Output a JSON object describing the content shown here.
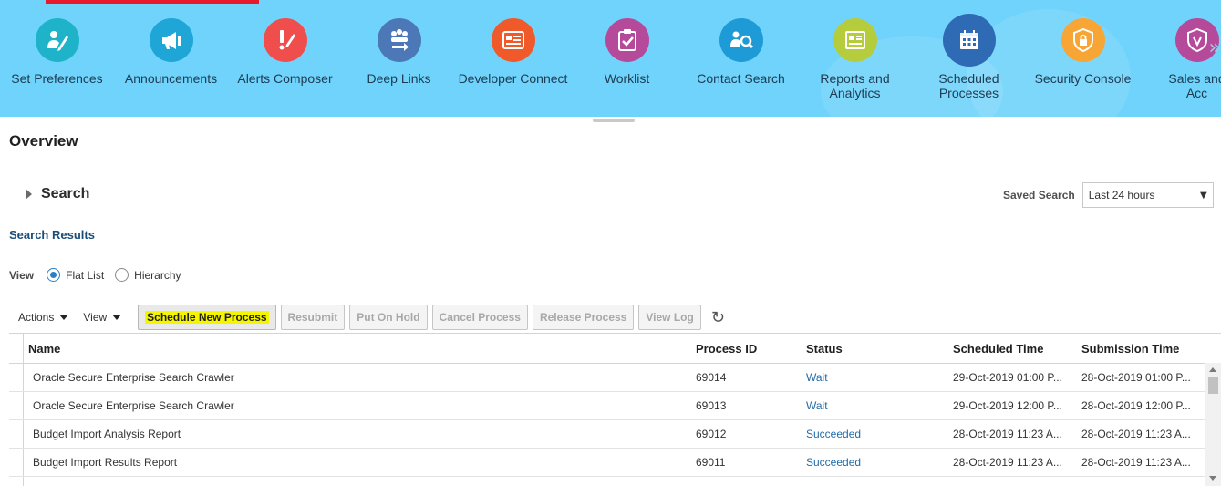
{
  "springboard": {
    "tiles": [
      {
        "label": "Set Preferences",
        "icon": "set-preferences-icon",
        "color": "#1fb3c9"
      },
      {
        "label": "Announcements",
        "icon": "megaphone-icon",
        "color": "#1fa5d6"
      },
      {
        "label": "Alerts Composer",
        "icon": "alert-composer-icon",
        "color": "#f04d4d"
      },
      {
        "label": "Deep Links",
        "icon": "deep-links-icon",
        "color": "#4c78b8"
      },
      {
        "label": "Developer Connect",
        "icon": "developer-connect-icon",
        "color": "#f05a2a"
      },
      {
        "label": "Worklist",
        "icon": "worklist-icon",
        "color": "#b64a9a"
      },
      {
        "label": "Contact Search",
        "icon": "contact-search-icon",
        "color": "#1e9ad6"
      },
      {
        "label": "Reports and Analytics",
        "icon": "reports-icon",
        "color": "#b5cc3d"
      },
      {
        "label": "Scheduled Processes",
        "icon": "calendar-icon",
        "color": "#2f6bb5"
      },
      {
        "label": "Security Console",
        "icon": "shield-lock-icon",
        "color": "#f7a535"
      },
      {
        "label": "Sales and Acc",
        "icon": "shield-icon",
        "color": "#b64a9a"
      }
    ],
    "chevron_glyph": "»"
  },
  "overview": {
    "title": "Overview",
    "search_label": "Search",
    "saved_search_label": "Saved Search",
    "saved_search_value": "Last 24 hours",
    "results_title": "Search Results"
  },
  "view": {
    "label": "View",
    "options": [
      "Flat List",
      "Hierarchy"
    ],
    "selected": "Flat List"
  },
  "toolbar": {
    "actions_label": "Actions",
    "view_label": "View",
    "buttons": {
      "schedule": "Schedule New Process",
      "resubmit": "Resubmit",
      "hold": "Put On Hold",
      "cancel": "Cancel Process",
      "release": "Release Process",
      "log": "View Log"
    },
    "refresh_glyph": "↻"
  },
  "table": {
    "columns": [
      "Name",
      "Process ID",
      "Status",
      "Scheduled Time",
      "Submission Time"
    ],
    "rows": [
      {
        "name": "Oracle Secure Enterprise Search Crawler",
        "pid": "69014",
        "status": "Wait",
        "scheduled": "29-Oct-2019 01:00 P...",
        "submitted": "28-Oct-2019 01:00 P..."
      },
      {
        "name": "Oracle Secure Enterprise Search Crawler",
        "pid": "69013",
        "status": "Wait",
        "scheduled": "29-Oct-2019 12:00 P...",
        "submitted": "28-Oct-2019 12:00 P..."
      },
      {
        "name": "Budget Import Analysis Report",
        "pid": "69012",
        "status": "Succeeded",
        "scheduled": "28-Oct-2019 11:23 A...",
        "submitted": "28-Oct-2019 11:23 A..."
      },
      {
        "name": "Budget Import Results Report",
        "pid": "69011",
        "status": "Succeeded",
        "scheduled": "28-Oct-2019 11:23 A...",
        "submitted": "28-Oct-2019 11:23 A..."
      }
    ]
  },
  "colors": {
    "springboard_bg": "#6fd3fb",
    "accent_red": "#e8192c",
    "link_blue": "#1f6aa8",
    "highlight": "#f5f500"
  }
}
